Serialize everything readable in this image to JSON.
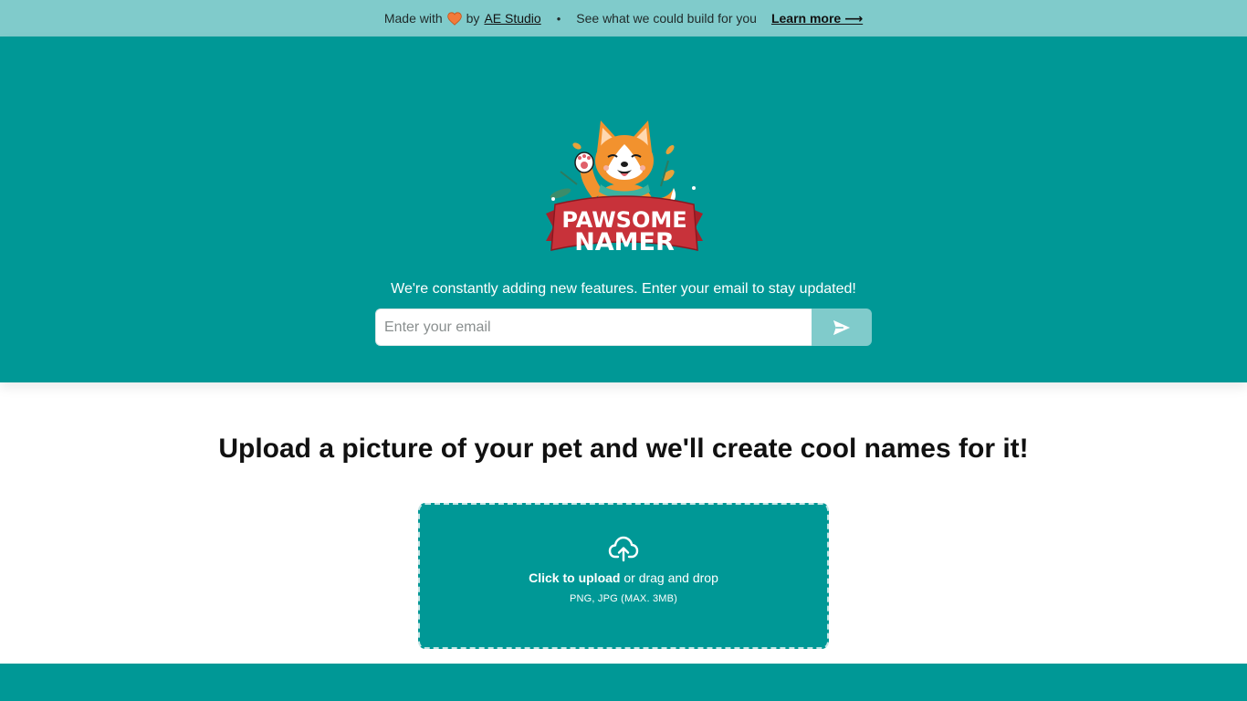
{
  "banner": {
    "made_with": "Made with",
    "by": "by",
    "studio_link": "AE Studio",
    "separator": "•",
    "pitch": "See what we could build for you",
    "learn_more": "Learn more ⟶",
    "heart_icon": "heart-icon"
  },
  "hero": {
    "logo_line1": "PAWSOME",
    "logo_line2": "NAMER",
    "tagline": "We're constantly adding new features. Enter your email to stay updated!",
    "email_placeholder": "Enter your email",
    "send_icon": "paper-plane-icon"
  },
  "main": {
    "headline": "Upload a picture of your pet and we'll create cool names for it!",
    "upload": {
      "icon": "cloud-upload-icon",
      "click_label": "Click to upload",
      "rest_label": " or drag and drop",
      "formats": "PNG, JPG (MAX. 3MB)"
    }
  },
  "colors": {
    "teal": "#009896",
    "light_teal": "#80cbcb",
    "banner_red": "#c8323a",
    "heart": "#f27a3a"
  }
}
